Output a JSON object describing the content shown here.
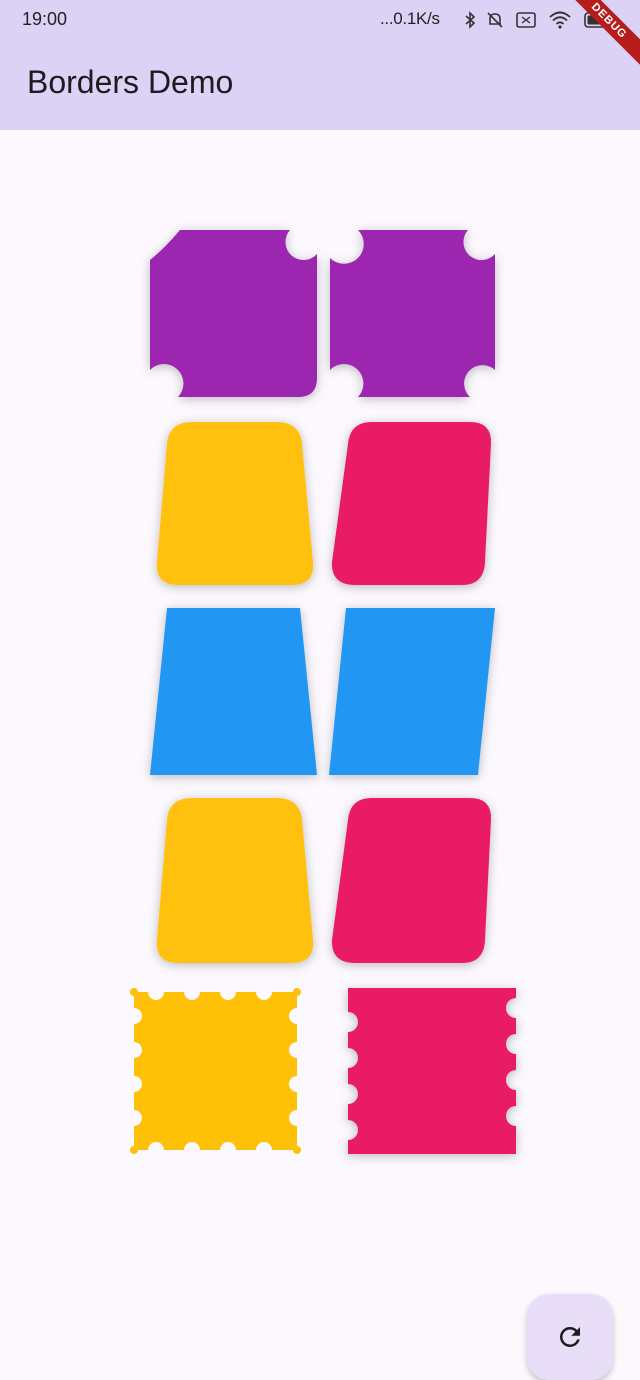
{
  "status": {
    "time": "19:00",
    "network_speed": "...0.1K/s",
    "icons": [
      "bluetooth-icon",
      "mute-icon",
      "sim-icon",
      "wifi-icon",
      "battery-icon"
    ]
  },
  "app_bar": {
    "title": "Borders Demo"
  },
  "debug_banner": "DEBUG",
  "fab": {
    "icon": "refresh-icon"
  },
  "colors": {
    "app_bar": "#dcd2f6",
    "background": "#fbf8fe",
    "purple": "#9c27b0",
    "amber": "#ffc107",
    "pink": "#e91e63",
    "blue": "#2196f3",
    "fab": "#e8def8"
  },
  "shapes": [
    {
      "name": "purple-beveled-shape-left",
      "color": "#9c27b0"
    },
    {
      "name": "purple-beveled-shape-right",
      "color": "#9c27b0"
    },
    {
      "name": "amber-trapezoid-shape",
      "color": "#ffc107"
    },
    {
      "name": "pink-skewed-shape",
      "color": "#e91e63"
    },
    {
      "name": "blue-trapezoid-shape",
      "color": "#2196f3"
    },
    {
      "name": "blue-parallelogram-shape",
      "color": "#2196f3"
    },
    {
      "name": "amber-trapezoid-shape-2",
      "color": "#ffc107"
    },
    {
      "name": "pink-skewed-shape-2",
      "color": "#e91e63"
    },
    {
      "name": "amber-stamp-shape",
      "color": "#ffc107"
    },
    {
      "name": "pink-ticket-shape",
      "color": "#e91e63"
    }
  ]
}
